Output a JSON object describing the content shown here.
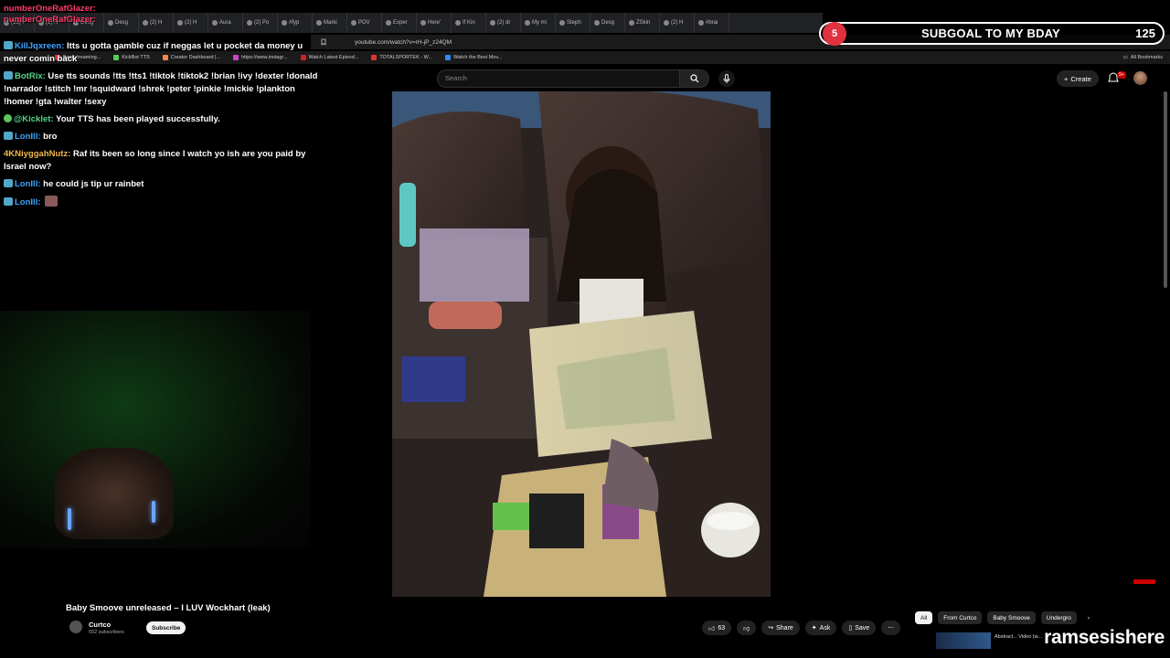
{
  "browser": {
    "tabs": [
      "(13) F",
      "(2) H",
      "Desg",
      "Desg",
      "(2) H",
      "(2) H",
      "Aura",
      "(2) Po",
      "#fyp",
      "Marki",
      "POV",
      "Exper",
      "Here'",
      "If Kin",
      "(2) dr",
      "My mi",
      "Steph",
      "Desg",
      "ZSkin",
      "(2) H",
      "#brai"
    ],
    "url": "youtube.com/watch?v=rH-jP_z24QM",
    "bookmarks": [
      "Best streaming...",
      "KickBot TTS",
      "Creator Dashboard |...",
      "https://www.instagr...",
      "Watch Latest Episod...",
      "TOTALSPORTEK - W...",
      "Watch the Best Mov..."
    ],
    "bookmark_colors": [
      "#d33",
      "#5c5",
      "#e84",
      "#c4c",
      "#c22",
      "#d33",
      "#38f"
    ],
    "all_bookmarks": "All Bookmarks"
  },
  "youtube": {
    "search_placeholder": "Search",
    "create_label": "Create",
    "notif_count": "9+",
    "video_title": "Baby Smoove unreleased – I LUV Wockhart (leak)",
    "channel_name": "Curtco",
    "channel_subs": "552 subscribers",
    "subscribe_label": "Subscribe",
    "likes": "63",
    "share_label": "Share",
    "ask_label": "Ask",
    "save_label": "Save",
    "chips": [
      "All",
      "From Curtco",
      "Baby Smoove",
      "Undergro"
    ],
    "related_title": "Abstract... Video (w...",
    "accent": "#cc0000"
  },
  "overlay": {
    "top_users": [
      "numberOneRafGlazer:",
      "numberOneRafGlazer:"
    ],
    "chat": [
      {
        "user": "KillJqxreen:",
        "text": "Itts u gotta gamble cuz if neggas let u pocket da money u never comin back",
        "color": "u-blue",
        "badge": "badge"
      },
      {
        "user": "BotRix:",
        "text": "Use tts sounds !tts !tts1 !tiktok !tiktok2 !brian !ivy !dexter !donald !narrador !stitch !mr !squidward !shrek !peter !pinkie !mickie !plankton !homer !gta !walter !sexy",
        "color": "u-green",
        "badge": "badge"
      },
      {
        "user": "@Kicklet:",
        "text": "Your TTS has been played successfully.",
        "color": "u-green",
        "badge": "gbadge"
      },
      {
        "user": "LonIll:",
        "text": "bro",
        "color": "u-blue",
        "badge": "badge"
      },
      {
        "user": "4KNiyggahNutz:",
        "text": "Raf its been so long since I watch yo ish are you paid by Israel now?",
        "color": "u-orange",
        "badge": ""
      },
      {
        "user": "LonIll:",
        "text": "he could js tip ur rainbet",
        "color": "u-blue",
        "badge": "badge"
      },
      {
        "user": "LonIll:",
        "text": "",
        "color": "u-blue",
        "badge": "badge"
      }
    ],
    "subgoal_badge": "5",
    "subgoal_text": "SUBGOAL TO MY BDAY",
    "subgoal_count": "125",
    "watermark": "ramsesishere"
  }
}
